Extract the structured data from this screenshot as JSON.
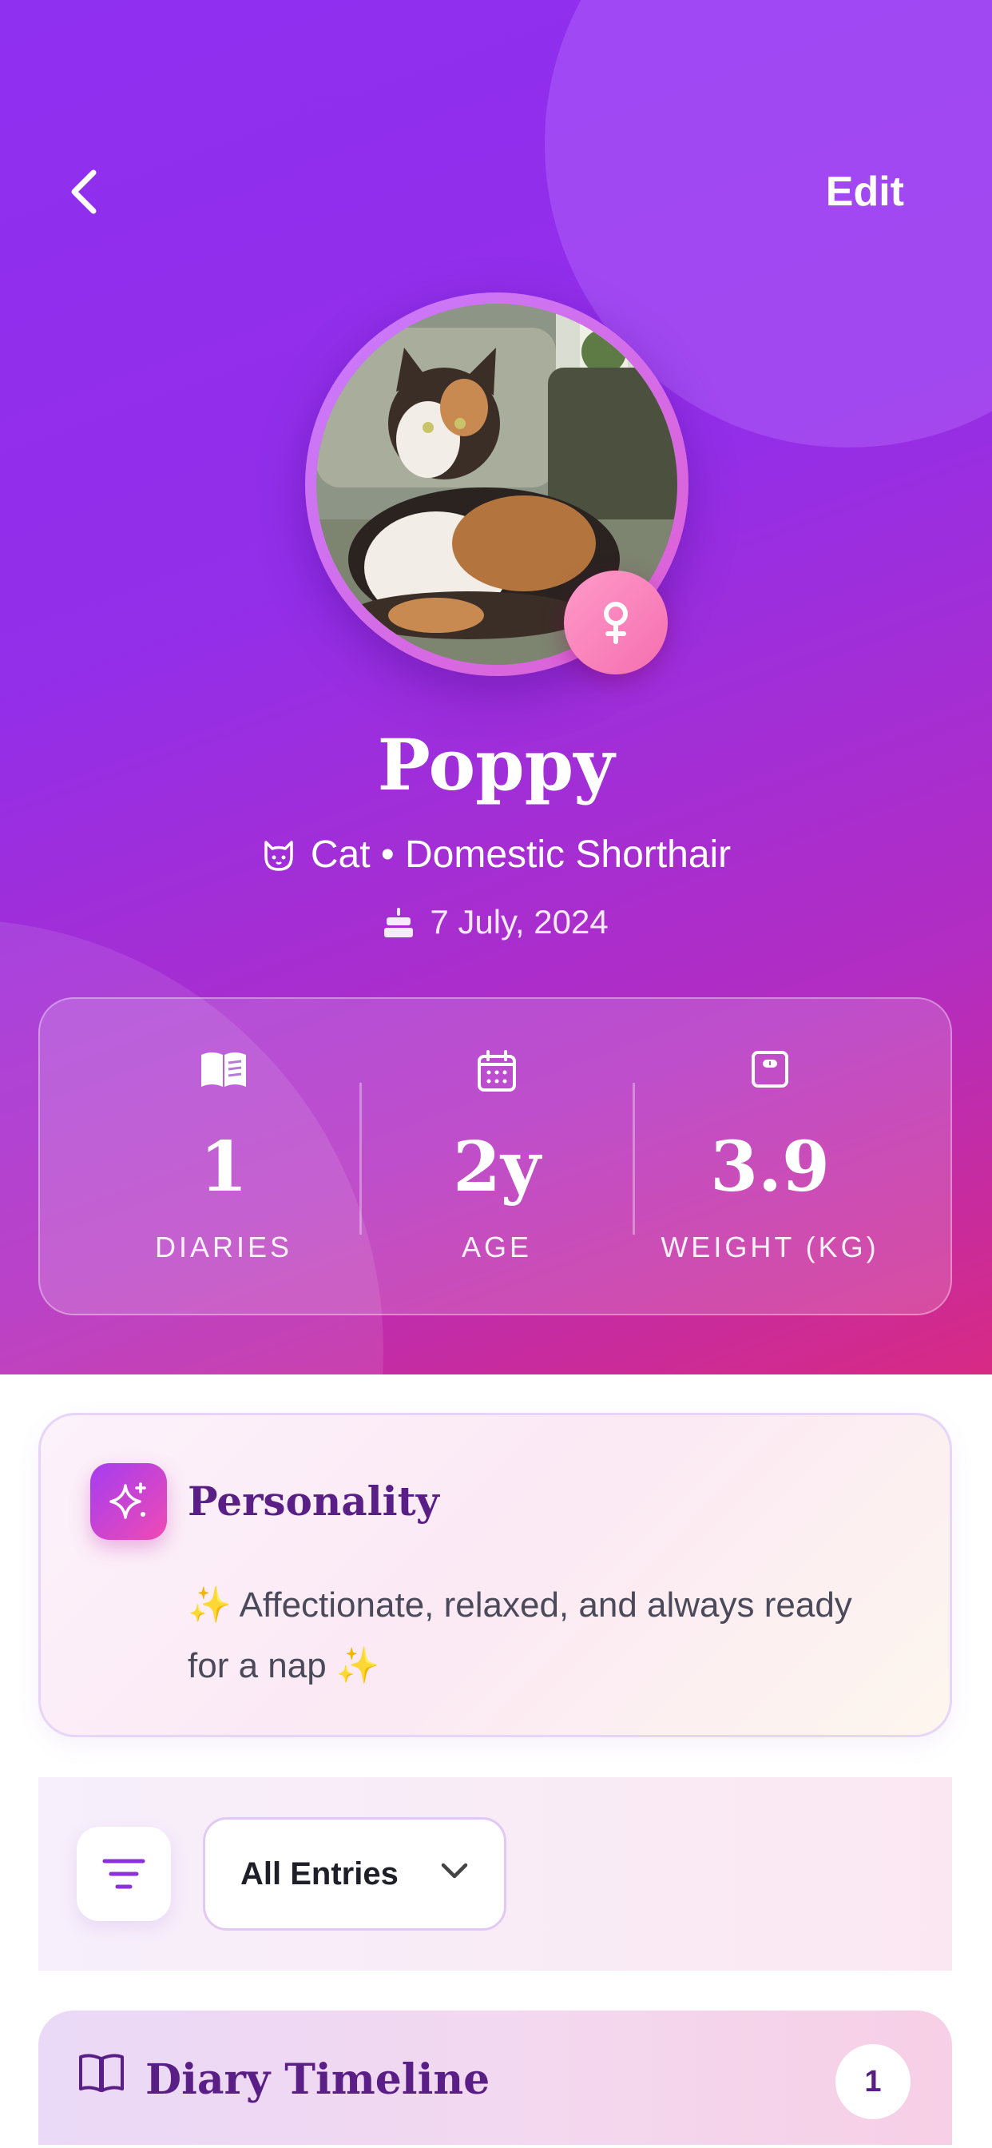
{
  "header": {
    "back_icon": "chevron-left-icon",
    "edit_label": "Edit"
  },
  "pet": {
    "name": "Poppy",
    "species_line": "Cat • Domestic Shorthair",
    "species_icon": "cat-face-icon",
    "birthday": "7 July, 2024",
    "birthday_icon": "cake-icon",
    "gender_icon": "female-icon"
  },
  "stats": [
    {
      "icon": "book-icon",
      "value": "1",
      "label": "DIARIES"
    },
    {
      "icon": "calendar-icon",
      "value": "2y",
      "label": "AGE"
    },
    {
      "icon": "scale-icon",
      "value": "3.9",
      "label": "WEIGHT (KG)"
    }
  ],
  "personality": {
    "title": "Personality",
    "icon": "sparkles-icon",
    "text": "✨  Affectionate, relaxed, and always ready for a nap ✨"
  },
  "filter": {
    "icon": "filter-icon",
    "selected": "All Entries"
  },
  "timeline": {
    "icon": "open-book-icon",
    "title": "Diary Timeline",
    "count": "1"
  },
  "colors": {
    "hero_start": "#8f2ff0",
    "hero_end": "#d72a84",
    "accent_text": "#5a1f86",
    "gender_badge": "#f46fb0"
  }
}
